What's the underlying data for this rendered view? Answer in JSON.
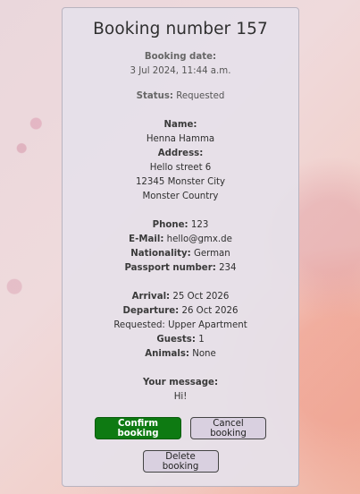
{
  "booking": {
    "title": "Booking number 157",
    "booking_date_label": "Booking date:",
    "booking_date_value": "3 Jul 2024, 11:44 a.m.",
    "status_label": "Status:",
    "status_value": "Requested",
    "name_label": "Name:",
    "name_value": "Henna Hamma",
    "address_label": "Address:",
    "address_line1": "Hello street 6",
    "address_line2": "12345 Monster City",
    "address_line3": "Monster Country",
    "phone_label": "Phone:",
    "phone_value": "123",
    "email_label": "E-Mail:",
    "email_value": "hello@gmx.de",
    "nationality_label": "Nationality:",
    "nationality_value": "German",
    "passport_label": "Passport number:",
    "passport_value": "234",
    "arrival_label": "Arrival:",
    "arrival_value": "25 Oct 2026",
    "departure_label": "Departure:",
    "departure_value": "26 Oct 2026",
    "requested_text": "Requested: Upper Apartment",
    "guests_label": "Guests:",
    "guests_value": "1",
    "animals_label": "Animals:",
    "animals_value": "None",
    "message_label": "Your message:",
    "message_value": "Hi!"
  },
  "actions": {
    "confirm_label": "Confirm booking",
    "cancel_label": "Cancel booking",
    "delete_label": "Delete booking"
  },
  "colors": {
    "confirm_button": "#0e7a12",
    "secondary_button": "#d9d0e0",
    "card_background": "#e6e0e9"
  }
}
